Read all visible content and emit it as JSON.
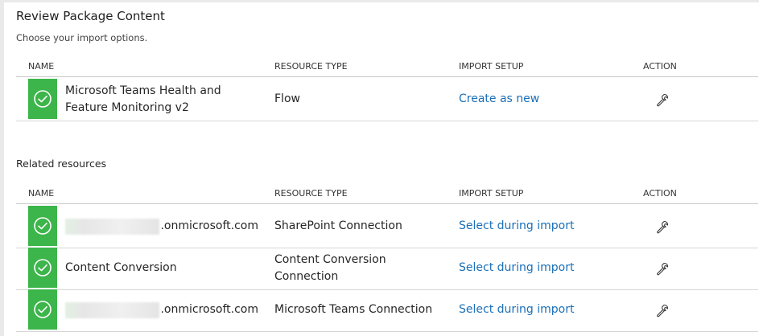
{
  "page": {
    "title": "Review Package Content",
    "subtitle": "Choose your import options.",
    "related_title": "Related resources"
  },
  "columns": {
    "name": "NAME",
    "resource_type": "RESOURCE TYPE",
    "import_setup": "IMPORT SETUP",
    "action": "ACTION"
  },
  "package": [
    {
      "name": "Microsoft Teams Health and Feature Monitoring v2",
      "resource_type": "Flow",
      "import_setup": "Create as new",
      "status": "check-circle-icon",
      "action_icon": "wrench-icon"
    }
  ],
  "related": [
    {
      "name": ".onmicrosoft.com",
      "name_redacted": true,
      "resource_type": "SharePoint Connection",
      "import_setup": "Select during import",
      "status": "check-circle-icon",
      "action_icon": "wrench-icon"
    },
    {
      "name": "Content Conversion",
      "name_redacted": false,
      "resource_type": "Content Conversion Connection",
      "import_setup": "Select during import",
      "status": "check-circle-icon",
      "action_icon": "wrench-icon"
    },
    {
      "name": ".onmicrosoft.com",
      "name_redacted": true,
      "resource_type": "Microsoft Teams Connection",
      "import_setup": "Select during import",
      "status": "check-circle-icon",
      "action_icon": "wrench-icon"
    }
  ],
  "colors": {
    "status_green": "#3cb54a",
    "link_blue": "#1a6fb8"
  }
}
